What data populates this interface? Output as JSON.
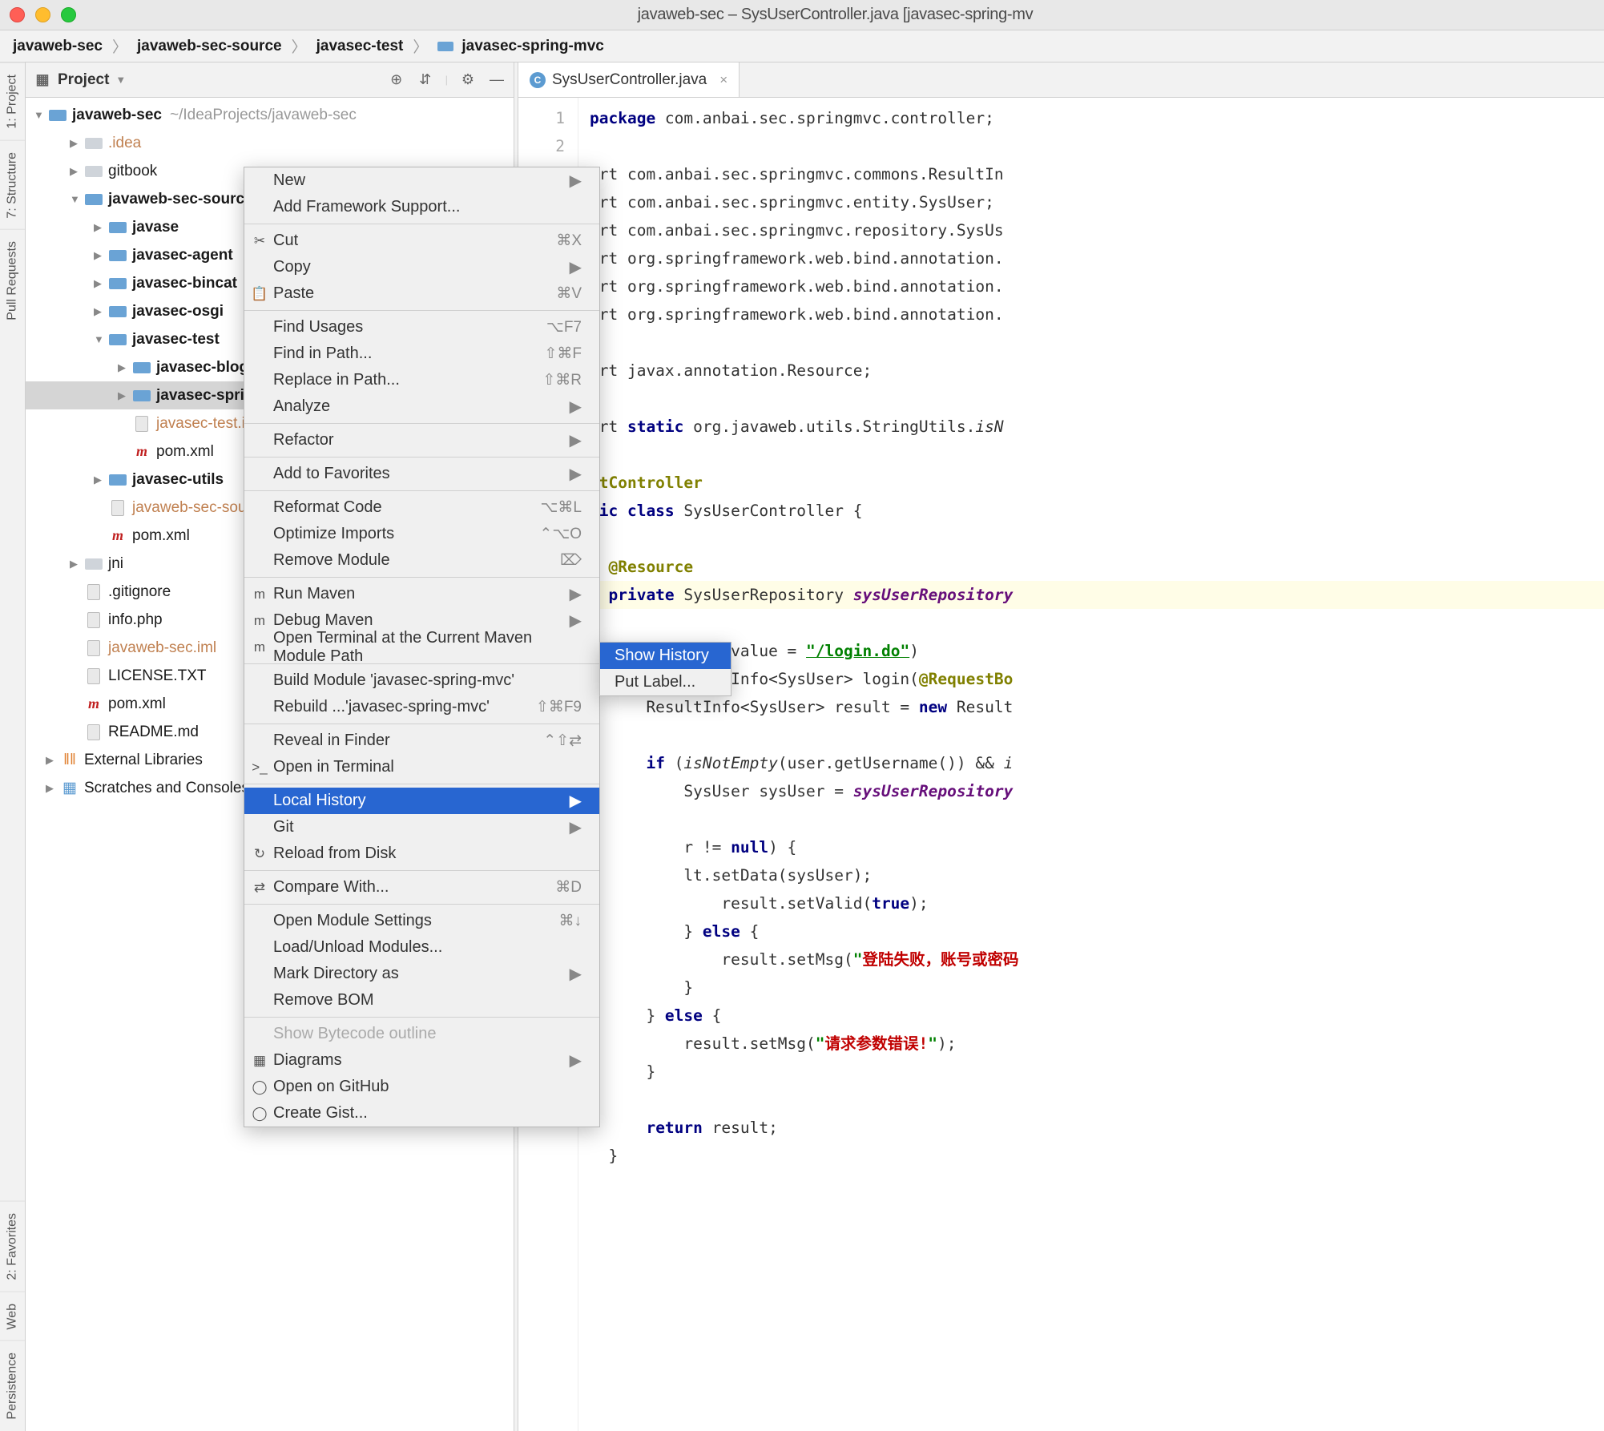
{
  "window": {
    "title": "javaweb-sec – SysUserController.java [javasec-spring-mv"
  },
  "breadcrumb": [
    "javaweb-sec",
    "javaweb-sec-source",
    "javasec-test",
    "javasec-spring-mvc"
  ],
  "rail": {
    "top": [
      "1: Project",
      "7: Structure",
      "Pull Requests"
    ],
    "bottom": [
      "2: Favorites",
      "Web",
      "Persistence"
    ]
  },
  "projectHeader": {
    "label": "Project"
  },
  "tree": {
    "root": {
      "name": "javaweb-sec",
      "hint": "~/IdeaProjects/javaweb-sec"
    },
    "items": [
      {
        "label": ".idea",
        "indent": 55,
        "arrow": "▶",
        "icon": "folder",
        "highlight": true
      },
      {
        "label": "gitbook",
        "indent": 55,
        "arrow": "▶",
        "icon": "folder"
      },
      {
        "label": "javaweb-sec-source",
        "indent": 55,
        "arrow": "▼",
        "icon": "folder-blue",
        "bold": true
      },
      {
        "label": "javase",
        "indent": 85,
        "arrow": "▶",
        "icon": "folder-blue",
        "bold": true
      },
      {
        "label": "javasec-agent",
        "indent": 85,
        "arrow": "▶",
        "icon": "folder-blue",
        "bold": true
      },
      {
        "label": "javasec-bincat",
        "indent": 85,
        "arrow": "▶",
        "icon": "folder-blue",
        "bold": true
      },
      {
        "label": "javasec-osgi",
        "indent": 85,
        "arrow": "▶",
        "icon": "folder-blue",
        "bold": true
      },
      {
        "label": "javasec-test",
        "indent": 85,
        "arrow": "▼",
        "icon": "folder-blue",
        "bold": true
      },
      {
        "label": "javasec-blog",
        "indent": 115,
        "arrow": "▶",
        "icon": "folder-blue",
        "bold": true
      },
      {
        "label": "javasec-spring-mvc",
        "indent": 115,
        "arrow": "▶",
        "icon": "folder-blue",
        "bold": true,
        "selected": true
      },
      {
        "label": "javasec-test.iml",
        "indent": 115,
        "arrow": "",
        "icon": "file",
        "highlight": true
      },
      {
        "label": "pom.xml",
        "indent": 115,
        "arrow": "",
        "icon": "maven"
      },
      {
        "label": "javasec-utils",
        "indent": 85,
        "arrow": "▶",
        "icon": "folder-blue",
        "bold": true
      },
      {
        "label": "javaweb-sec-source.iml",
        "indent": 85,
        "arrow": "",
        "icon": "file",
        "highlight": true
      },
      {
        "label": "pom.xml",
        "indent": 85,
        "arrow": "",
        "icon": "maven"
      },
      {
        "label": "jni",
        "indent": 55,
        "arrow": "▶",
        "icon": "folder"
      },
      {
        "label": ".gitignore",
        "indent": 55,
        "arrow": "",
        "icon": "file"
      },
      {
        "label": "info.php",
        "indent": 55,
        "arrow": "",
        "icon": "file"
      },
      {
        "label": "javaweb-sec.iml",
        "indent": 55,
        "arrow": "",
        "icon": "file",
        "highlight": true
      },
      {
        "label": "LICENSE.TXT",
        "indent": 55,
        "arrow": "",
        "icon": "file"
      },
      {
        "label": "pom.xml",
        "indent": 55,
        "arrow": "",
        "icon": "maven"
      },
      {
        "label": "README.md",
        "indent": 55,
        "arrow": "",
        "icon": "file"
      }
    ],
    "extLibs": "External Libraries",
    "scratches": "Scratches and Consoles"
  },
  "editor": {
    "tab": "SysUserController.java",
    "lineNumbers": [
      "1",
      "2"
    ],
    "code": [
      "<span class='kw'>package</span> com.anbai.sec.springmvc.controller;",
      "",
      "ort com.anbai.sec.springmvc.commons.ResultIn",
      "ort com.anbai.sec.springmvc.entity.SysUser;",
      "ort com.anbai.sec.springmvc.repository.SysUs",
      "ort org.springframework.web.bind.annotation.",
      "ort org.springframework.web.bind.annotation.",
      "ort org.springframework.web.bind.annotation.",
      "",
      "ort javax.annotation.Resource;",
      "",
      "ort <span class='kw'>static</span> org.javaweb.utils.StringUtils.<i>isN</i>",
      "",
      "<span class='anno'>stController</span>",
      "<span class='kw'>lic class</span> SysUserController {",
      "",
      "  <span class='anno'>@Resource</span>",
      "<span class='hl-line'>  <span class='kw'>private</span> SysUserRepository <span class='field'>sysUserRepository</span></span>",
      "",
      "  <span class='anno'>@PostMapping</span>(value = <span class='link'>\"/login.do\"</span>)",
      "  <span class='kw'>public</span> ResultInfo&lt;SysUser&gt; login(<span class='anno'>@RequestBo</span>",
      "      ResultInfo&lt;SysUser&gt; result = <span class='kw'>new</span> Result",
      "",
      "      <span class='kw'>if</span> (<i>isNotEmpty</i>(user.getUsername()) &amp;&amp; <i>i</i>",
      "          SysUser sysUser = <span class='field'>sysUserRepository</span>",
      "",
      "          r != <span class='kw'>null</span>) {",
      "          lt.setData(sysUser);",
      "              result.setValid(<span class='kw'>true</span>);",
      "          } <span class='kw'>else</span> {",
      "              result.setMsg(<span class='str'>\"</span><span class='str-red'>登陆失败，账号或密码</span>",
      "          }",
      "      } <span class='kw'>else</span> {",
      "          result.setMsg(<span class='str'>\"</span><span class='str-red'>请求参数错误!</span><span class='str'>\"</span>);",
      "      }",
      "",
      "      <span class='kw'>return</span> result;",
      "  }"
    ]
  },
  "contextMenu": [
    {
      "type": "item",
      "label": "New",
      "arrow": true
    },
    {
      "type": "item",
      "label": "Add Framework Support..."
    },
    {
      "type": "sep"
    },
    {
      "type": "item",
      "label": "Cut",
      "shortcut": "⌘X",
      "icon": "✂"
    },
    {
      "type": "item",
      "label": "Copy",
      "arrow": true
    },
    {
      "type": "item",
      "label": "Paste",
      "shortcut": "⌘V",
      "icon": "📋"
    },
    {
      "type": "sep"
    },
    {
      "type": "item",
      "label": "Find Usages",
      "shortcut": "⌥F7"
    },
    {
      "type": "item",
      "label": "Find in Path...",
      "shortcut": "⇧⌘F"
    },
    {
      "type": "item",
      "label": "Replace in Path...",
      "shortcut": "⇧⌘R"
    },
    {
      "type": "item",
      "label": "Analyze",
      "arrow": true
    },
    {
      "type": "sep"
    },
    {
      "type": "item",
      "label": "Refactor",
      "arrow": true
    },
    {
      "type": "sep"
    },
    {
      "type": "item",
      "label": "Add to Favorites",
      "arrow": true
    },
    {
      "type": "sep"
    },
    {
      "type": "item",
      "label": "Reformat Code",
      "shortcut": "⌥⌘L"
    },
    {
      "type": "item",
      "label": "Optimize Imports",
      "shortcut": "⌃⌥O"
    },
    {
      "type": "item",
      "label": "Remove Module",
      "shortcut": "⌦"
    },
    {
      "type": "sep"
    },
    {
      "type": "item",
      "label": "Run Maven",
      "arrow": true,
      "icon": "m"
    },
    {
      "type": "item",
      "label": "Debug Maven",
      "arrow": true,
      "icon": "m"
    },
    {
      "type": "item",
      "label": "Open Terminal at the Current Maven Module Path",
      "icon": "m"
    },
    {
      "type": "sep"
    },
    {
      "type": "item",
      "label": "Build Module 'javasec-spring-mvc'"
    },
    {
      "type": "item",
      "label": "Rebuild ...'javasec-spring-mvc'",
      "shortcut": "⇧⌘F9"
    },
    {
      "type": "sep"
    },
    {
      "type": "item",
      "label": "Reveal in Finder",
      "shortcut": "⌃⇧⇄"
    },
    {
      "type": "item",
      "label": "Open in Terminal",
      "icon": ">_"
    },
    {
      "type": "sep"
    },
    {
      "type": "item",
      "label": "Local History",
      "arrow": true,
      "highlight": true
    },
    {
      "type": "item",
      "label": "Git",
      "arrow": true
    },
    {
      "type": "item",
      "label": "Reload from Disk",
      "icon": "↻"
    },
    {
      "type": "sep"
    },
    {
      "type": "item",
      "label": "Compare With...",
      "shortcut": "⌘D",
      "icon": "⇄"
    },
    {
      "type": "sep"
    },
    {
      "type": "item",
      "label": "Open Module Settings",
      "shortcut": "⌘↓"
    },
    {
      "type": "item",
      "label": "Load/Unload Modules..."
    },
    {
      "type": "item",
      "label": "Mark Directory as",
      "arrow": true
    },
    {
      "type": "item",
      "label": "Remove BOM"
    },
    {
      "type": "sep"
    },
    {
      "type": "item",
      "label": "Show Bytecode outline",
      "disabled": true
    },
    {
      "type": "item",
      "label": "Diagrams",
      "arrow": true,
      "icon": "▦"
    },
    {
      "type": "item",
      "label": "Open on GitHub",
      "icon": "◯"
    },
    {
      "type": "item",
      "label": "Create Gist...",
      "icon": "◯"
    }
  ],
  "submenu": [
    {
      "label": "Show History",
      "highlight": true
    },
    {
      "label": "Put Label..."
    }
  ]
}
